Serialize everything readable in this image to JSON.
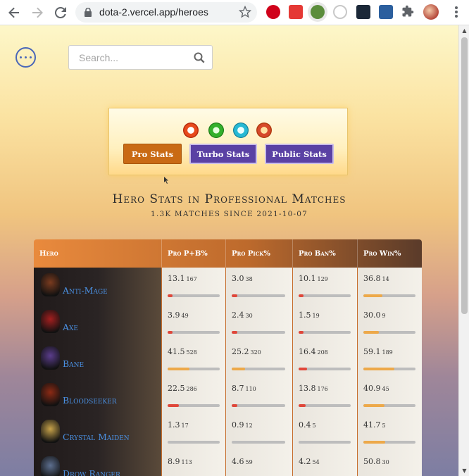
{
  "browser": {
    "url": "dota-2.vercel.app/heroes"
  },
  "search": {
    "placeholder": "Search..."
  },
  "stats_buttons": [
    {
      "label": "Pro Stats"
    },
    {
      "label": "Turbo Stats"
    },
    {
      "label": "Public Stats"
    }
  ],
  "heading": {
    "title": "Hero Stats in Professional Matches",
    "subtitle": "1.3K MATCHES SINCE 2021-10-07"
  },
  "table": {
    "columns": [
      "Hero",
      "Pro P+B%",
      "Pro Pick%",
      "Pro Ban%",
      "Pro Win%"
    ],
    "rows": [
      {
        "hero": "Anti-Mage",
        "portrait_color": "#7a3b1f",
        "pb": {
          "v": "13.1",
          "n": "167",
          "fill": 0.07,
          "color": "red"
        },
        "pick": {
          "v": "3.0",
          "n": "38",
          "fill": 0.04,
          "color": "red"
        },
        "ban": {
          "v": "10.1",
          "n": "129",
          "fill": 0.07,
          "color": "red"
        },
        "win": {
          "v": "36.8",
          "n": "14",
          "fill": 0.37,
          "color": "orange"
        }
      },
      {
        "hero": "Axe",
        "portrait_color": "#a31f1f",
        "pb": {
          "v": "3.9",
          "n": "49",
          "fill": 0.04,
          "color": "red"
        },
        "pick": {
          "v": "2.4",
          "n": "30",
          "fill": 0.03,
          "color": "red"
        },
        "ban": {
          "v": "1.5",
          "n": "19",
          "fill": 0.02,
          "color": "red"
        },
        "win": {
          "v": "30.0",
          "n": "9",
          "fill": 0.3,
          "color": "orange"
        }
      },
      {
        "hero": "Bane",
        "portrait_color": "#5b3d8c",
        "pb": {
          "v": "41.5",
          "n": "528",
          "fill": 0.42,
          "color": "orange"
        },
        "pick": {
          "v": "25.2",
          "n": "320",
          "fill": 0.25,
          "color": "orange"
        },
        "ban": {
          "v": "16.4",
          "n": "208",
          "fill": 0.16,
          "color": "red"
        },
        "win": {
          "v": "59.1",
          "n": "189",
          "fill": 0.59,
          "color": "orange"
        }
      },
      {
        "hero": "Bloodseeker",
        "portrait_color": "#8c2a14",
        "pb": {
          "v": "22.5",
          "n": "286",
          "fill": 0.22,
          "color": "red"
        },
        "pick": {
          "v": "8.7",
          "n": "110",
          "fill": 0.05,
          "color": "red"
        },
        "ban": {
          "v": "13.8",
          "n": "176",
          "fill": 0.14,
          "color": "red"
        },
        "win": {
          "v": "40.9",
          "n": "45",
          "fill": 0.41,
          "color": "orange"
        }
      },
      {
        "hero": "Crystal Maiden",
        "portrait_color": "#c7a24a",
        "pb": {
          "v": "1.3",
          "n": "17",
          "fill": 0.0,
          "color": "red"
        },
        "pick": {
          "v": "0.9",
          "n": "12",
          "fill": 0.0,
          "color": "red"
        },
        "ban": {
          "v": "0.4",
          "n": "5",
          "fill": 0.0,
          "color": "red"
        },
        "win": {
          "v": "41.7",
          "n": "5",
          "fill": 0.42,
          "color": "orange"
        }
      },
      {
        "hero": "Drow Ranger",
        "portrait_color": "#5d6f8f",
        "pb": {
          "v": "8.9",
          "n": "113",
          "fill": 0.06,
          "color": "red"
        },
        "pick": {
          "v": "4.6",
          "n": "59",
          "fill": 0.04,
          "color": "red"
        },
        "ban": {
          "v": "4.2",
          "n": "54",
          "fill": 0.04,
          "color": "red"
        },
        "win": {
          "v": "50.8",
          "n": "30",
          "fill": 0.5,
          "color": "orange"
        }
      }
    ]
  }
}
